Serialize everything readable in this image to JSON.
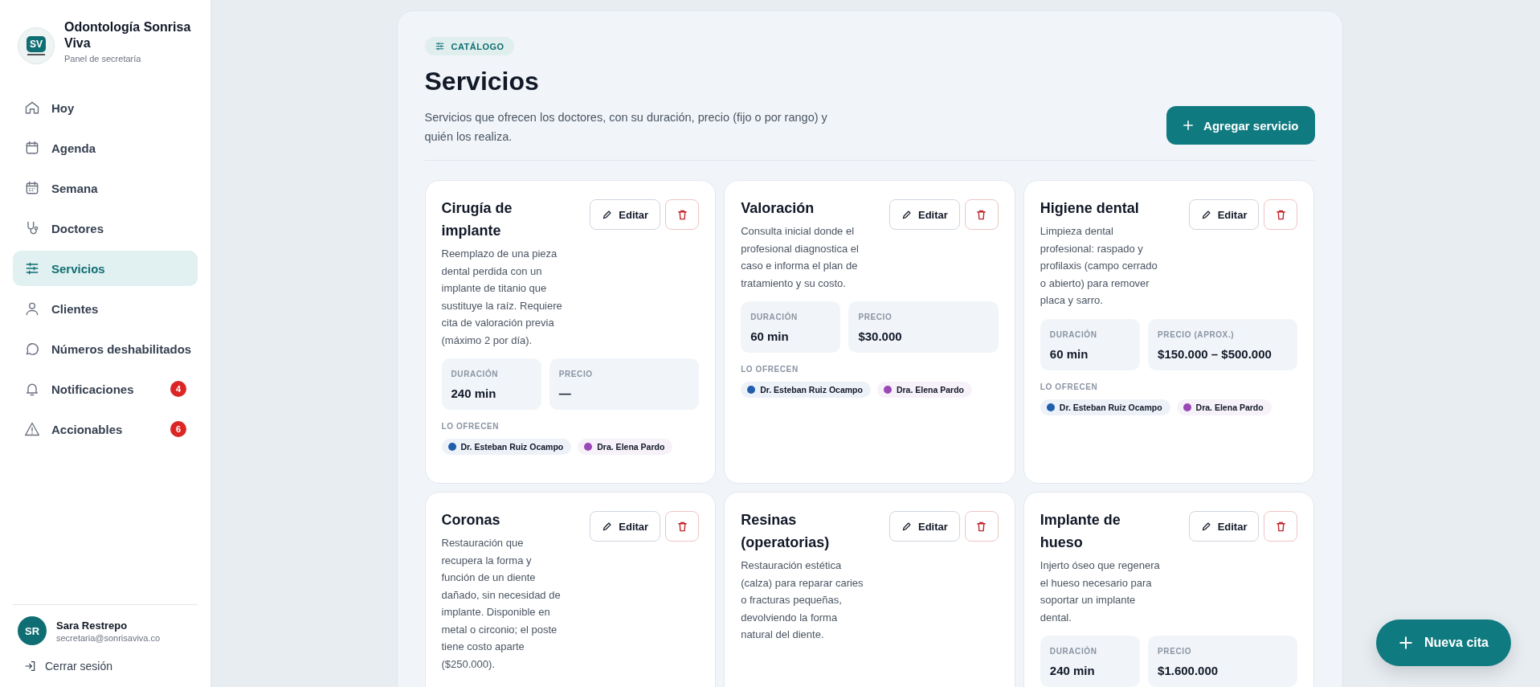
{
  "sidebar": {
    "logo": "SV",
    "title": "Odontología Sonrisa Viva",
    "subtitle": "Panel de secretaría",
    "items": [
      {
        "label": "Hoy",
        "selected": false
      },
      {
        "label": "Agenda",
        "selected": false
      },
      {
        "label": "Semana",
        "selected": false
      },
      {
        "label": "Doctores",
        "selected": false
      },
      {
        "label": "Servicios",
        "selected": true
      },
      {
        "label": "Clientes",
        "selected": false
      },
      {
        "label": "Números deshabilitados",
        "selected": false
      },
      {
        "label": "Notificaciones",
        "selected": false,
        "badge": "4"
      },
      {
        "label": "Accionables",
        "selected": false,
        "badge": "6"
      }
    ],
    "user": {
      "initials": "SR",
      "name": "Sara Restrepo",
      "email": "secretaria@sonrisaviva.co"
    },
    "logout": "Cerrar sesión"
  },
  "header": {
    "eyebrow": "CATÁLOGO",
    "title": "Servicios",
    "description": "Servicios que ofrecen los doctores, con su duración, precio (fijo o por rango) y quién los realiza.",
    "add_button": "Agregar servicio"
  },
  "services": [
    {
      "name": "Cirugía de implante",
      "description": "Reemplazo de una pieza dental perdida con un implante de titanio que sustituye la raíz. Requiere cita de valoración previa (máximo 2 por día).",
      "edit": "Editar",
      "stats": [
        {
          "label": "DURACIÓN",
          "value": "240 min"
        },
        {
          "label": "PRECIO",
          "value": "—"
        }
      ],
      "offered_label": "LO OFRECEN",
      "doctors": [
        {
          "name": "Dr. Esteban Ruiz Ocampo",
          "color": "#1f5fae"
        },
        {
          "name": "Dra. Elena Pardo",
          "color": "#9a47b8"
        }
      ]
    },
    {
      "name": "Valoración",
      "description": "Consulta inicial donde el profesional diagnostica el caso e informa el plan de tratamiento y su costo.",
      "edit": "Editar",
      "stats": [
        {
          "label": "DURACIÓN",
          "value": "60 min"
        },
        {
          "label": "PRECIO",
          "value": "$30.000"
        }
      ],
      "offered_label": "LO OFRECEN",
      "doctors": [
        {
          "name": "Dr. Esteban Ruiz Ocampo",
          "color": "#1f5fae"
        },
        {
          "name": "Dra. Elena Pardo",
          "color": "#9a47b8"
        }
      ]
    },
    {
      "name": "Higiene dental",
      "description": "Limpieza dental profesional: raspado y profilaxis (campo cerrado o abierto) para remover placa y sarro.",
      "edit": "Editar",
      "stats": [
        {
          "label": "DURACIÓN",
          "value": "60 min"
        },
        {
          "label": "PRECIO (APROX.)",
          "value": "$150.000 – $500.000"
        }
      ],
      "offered_label": "LO OFRECEN",
      "doctors": [
        {
          "name": "Dr. Esteban Ruiz Ocampo",
          "color": "#1f5fae"
        },
        {
          "name": "Dra. Elena Pardo",
          "color": "#9a47b8"
        }
      ]
    },
    {
      "name": "Coronas",
      "description": "Restauración que recupera la forma y función de un diente dañado, sin necesidad de implante. Disponible en metal o circonio; el poste tiene costo aparte ($250.000).",
      "edit": "Editar"
    },
    {
      "name": "Resinas (operatorias)",
      "description": "Restauración estética (calza) para reparar caries o fracturas pequeñas, devolviendo la forma natural del diente.",
      "edit": "Editar"
    },
    {
      "name": "Implante de hueso",
      "description": "Injerto óseo que regenera el hueso necesario para soportar un implante dental.",
      "edit": "Editar",
      "stats": [
        {
          "label": "DURACIÓN",
          "value": "240 min"
        },
        {
          "label": "PRECIO",
          "value": "$1.600.000"
        }
      ]
    }
  ],
  "fab": "Nueva cita"
}
